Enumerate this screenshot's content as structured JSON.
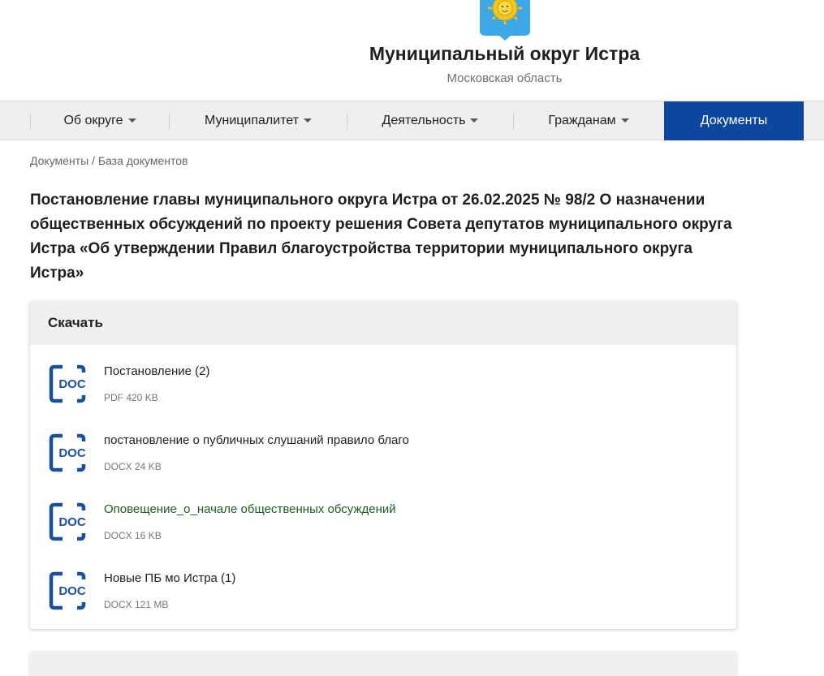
{
  "header": {
    "title": "Муниципальный округ Истра",
    "subtitle": "Московская область",
    "emblem_icon": "sun-emblem-icon"
  },
  "nav": {
    "items": [
      {
        "label": "Об округе",
        "has_dropdown": true
      },
      {
        "label": "Муниципалитет",
        "has_dropdown": true
      },
      {
        "label": "Деятельность",
        "has_dropdown": true
      },
      {
        "label": "Гражданам",
        "has_dropdown": true
      },
      {
        "label": "Документы",
        "has_dropdown": false,
        "active": true
      }
    ],
    "active_color": "#0d46a0"
  },
  "breadcrumb": {
    "first": "Документы",
    "separator": " / ",
    "second": "База документов"
  },
  "document": {
    "title": "Постановление главы муниципального округа Истра от 26.02.2025 № 98/2 О назначении общественных обсуждений по проекту решения Совета депутатов муниципального округа Истра «Об утверждении Правил благоустройства территории муниципального округа Истра»"
  },
  "downloads": {
    "heading": "Скачать",
    "icon_label": "DOC",
    "icon_color": "#1a4f9c",
    "files": [
      {
        "name": "Постановление (2)",
        "size": "PDF 420 KB"
      },
      {
        "name": "постановление о публичных слушаний правило благо",
        "size": "DOCX 24 KB"
      },
      {
        "name": "Оповещение_о_начале общественных обсуждений",
        "size": "DOCX 16 KB",
        "visited": true
      },
      {
        "name": "Новые ПБ мо Истра (1)",
        "size": "DOCX 121 MB"
      }
    ]
  }
}
